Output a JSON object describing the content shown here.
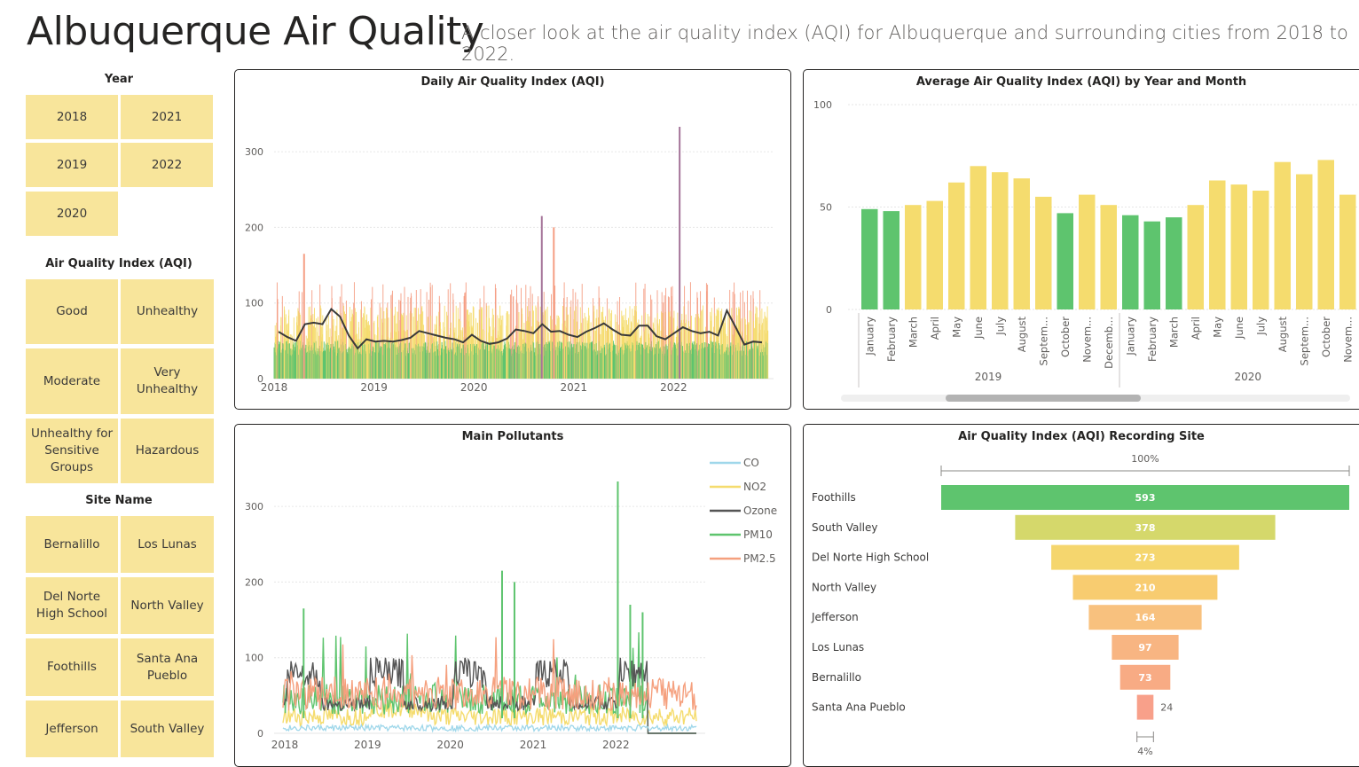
{
  "header": {
    "title": "Albuquerque Air Quality",
    "subtitle": "A closer look at the air quality index (AQI) for Albuquerque and surrounding cities from 2018 to 2022."
  },
  "slicers": {
    "year": {
      "title": "Year",
      "items": [
        "2018",
        "2021",
        "2019",
        "2022",
        "2020"
      ]
    },
    "aqi": {
      "title": "Air Quality Index (AQI)",
      "items": [
        "Good",
        "Unhealthy",
        "Moderate",
        "Very Unhealthy",
        "Unhealthy for Sensitive Groups",
        "Hazardous"
      ]
    },
    "site": {
      "title": "Site Name",
      "items": [
        "Bernalillo",
        "Los Lunas",
        "Del Norte High School",
        "North Valley",
        "Foothills",
        "Santa Ana Pueblo",
        "Jefferson",
        "South Valley"
      ]
    }
  },
  "colors": {
    "good": "#5ec46e",
    "moderate": "#f5dc6e",
    "sensitive": "#f59e84",
    "unhealthy": "#a47398",
    "tile": "#f8e59b",
    "line": "#3a3a3a"
  },
  "chart_data": [
    {
      "type": "line",
      "title": "Daily Air Quality Index (AQI)",
      "x": [
        "2018",
        "2019",
        "2020",
        "2021",
        "2022"
      ],
      "yticks": [
        0,
        100,
        200,
        300
      ],
      "ylim": [
        0,
        340
      ],
      "monthly_avg_line": [
        62,
        55,
        50,
        72,
        74,
        72,
        92,
        82,
        57,
        40,
        52,
        49,
        50,
        49,
        51,
        54,
        63,
        60,
        57,
        54,
        52,
        48,
        58,
        50,
        46,
        48,
        53,
        65,
        63,
        60,
        72,
        62,
        63,
        58,
        55,
        62,
        67,
        73,
        65,
        58,
        57,
        70,
        70,
        56,
        52,
        60,
        68,
        63,
        60,
        62,
        57,
        90,
        68,
        45,
        49,
        48
      ],
      "spikes": [
        {
          "year": 2020.68,
          "aqi": 215
        },
        {
          "year": 2022.06,
          "aqi": 333
        },
        {
          "year": 2018.3,
          "aqi": 165
        },
        {
          "year": 2020.8,
          "aqi": 200
        }
      ]
    },
    {
      "type": "bar",
      "title": "Average Air Quality Index (AQI) by Year and Month",
      "categories": [
        "January",
        "February",
        "March",
        "April",
        "May",
        "June",
        "July",
        "August",
        "Septem...",
        "October",
        "Novem...",
        "Decemb...",
        "January",
        "February",
        "March",
        "April",
        "May",
        "June",
        "July",
        "August",
        "Septem...",
        "October",
        "Novem..."
      ],
      "groups": [
        {
          "label": "2019",
          "start": 0,
          "end": 12
        },
        {
          "label": "2020",
          "start": 12,
          "end": 23
        }
      ],
      "values": [
        49,
        48,
        51,
        53,
        62,
        70,
        67,
        64,
        55,
        47,
        56,
        51,
        46,
        43,
        45,
        51,
        63,
        61,
        58,
        72,
        66,
        73,
        56
      ],
      "good": [
        1,
        1,
        0,
        0,
        0,
        0,
        0,
        0,
        0,
        1,
        0,
        0,
        1,
        1,
        1,
        0,
        0,
        0,
        0,
        0,
        0,
        0,
        0
      ],
      "yticks": [
        0,
        50,
        100
      ],
      "ylim": [
        0,
        100
      ]
    },
    {
      "type": "line",
      "title": "Main Pollutants",
      "legend": [
        "CO",
        "NO2",
        "Ozone",
        "PM10",
        "PM2.5"
      ],
      "legend_colors": [
        "#9fd7ea",
        "#f5dc6e",
        "#555555",
        "#5ec46e",
        "#f5a07e"
      ],
      "x": [
        "2018",
        "2019",
        "2020",
        "2021",
        "2022"
      ],
      "yticks": [
        0,
        100,
        200,
        300
      ],
      "ylim": [
        0,
        340
      ]
    },
    {
      "type": "bar",
      "title": "Air Quality Index (AQI) Recording Site",
      "top_label": "100%",
      "bottom_label": "4%",
      "categories": [
        "Foothills",
        "South Valley",
        "Del Norte High School",
        "North Valley",
        "Jefferson",
        "Los Lunas",
        "Bernalillo",
        "Santa Ana Pueblo"
      ],
      "values": [
        593,
        378,
        273,
        210,
        164,
        97,
        73,
        24
      ],
      "value_labels": [
        "593",
        "378",
        "273",
        "210",
        "164",
        "97",
        "73",
        "24"
      ],
      "bar_colors": [
        "#5ec46e",
        "#d5d86b",
        "#f5d66e",
        "#f8cc70",
        "#f8c17e",
        "#f8b582",
        "#f8ab84",
        "#f8a08a"
      ]
    }
  ]
}
